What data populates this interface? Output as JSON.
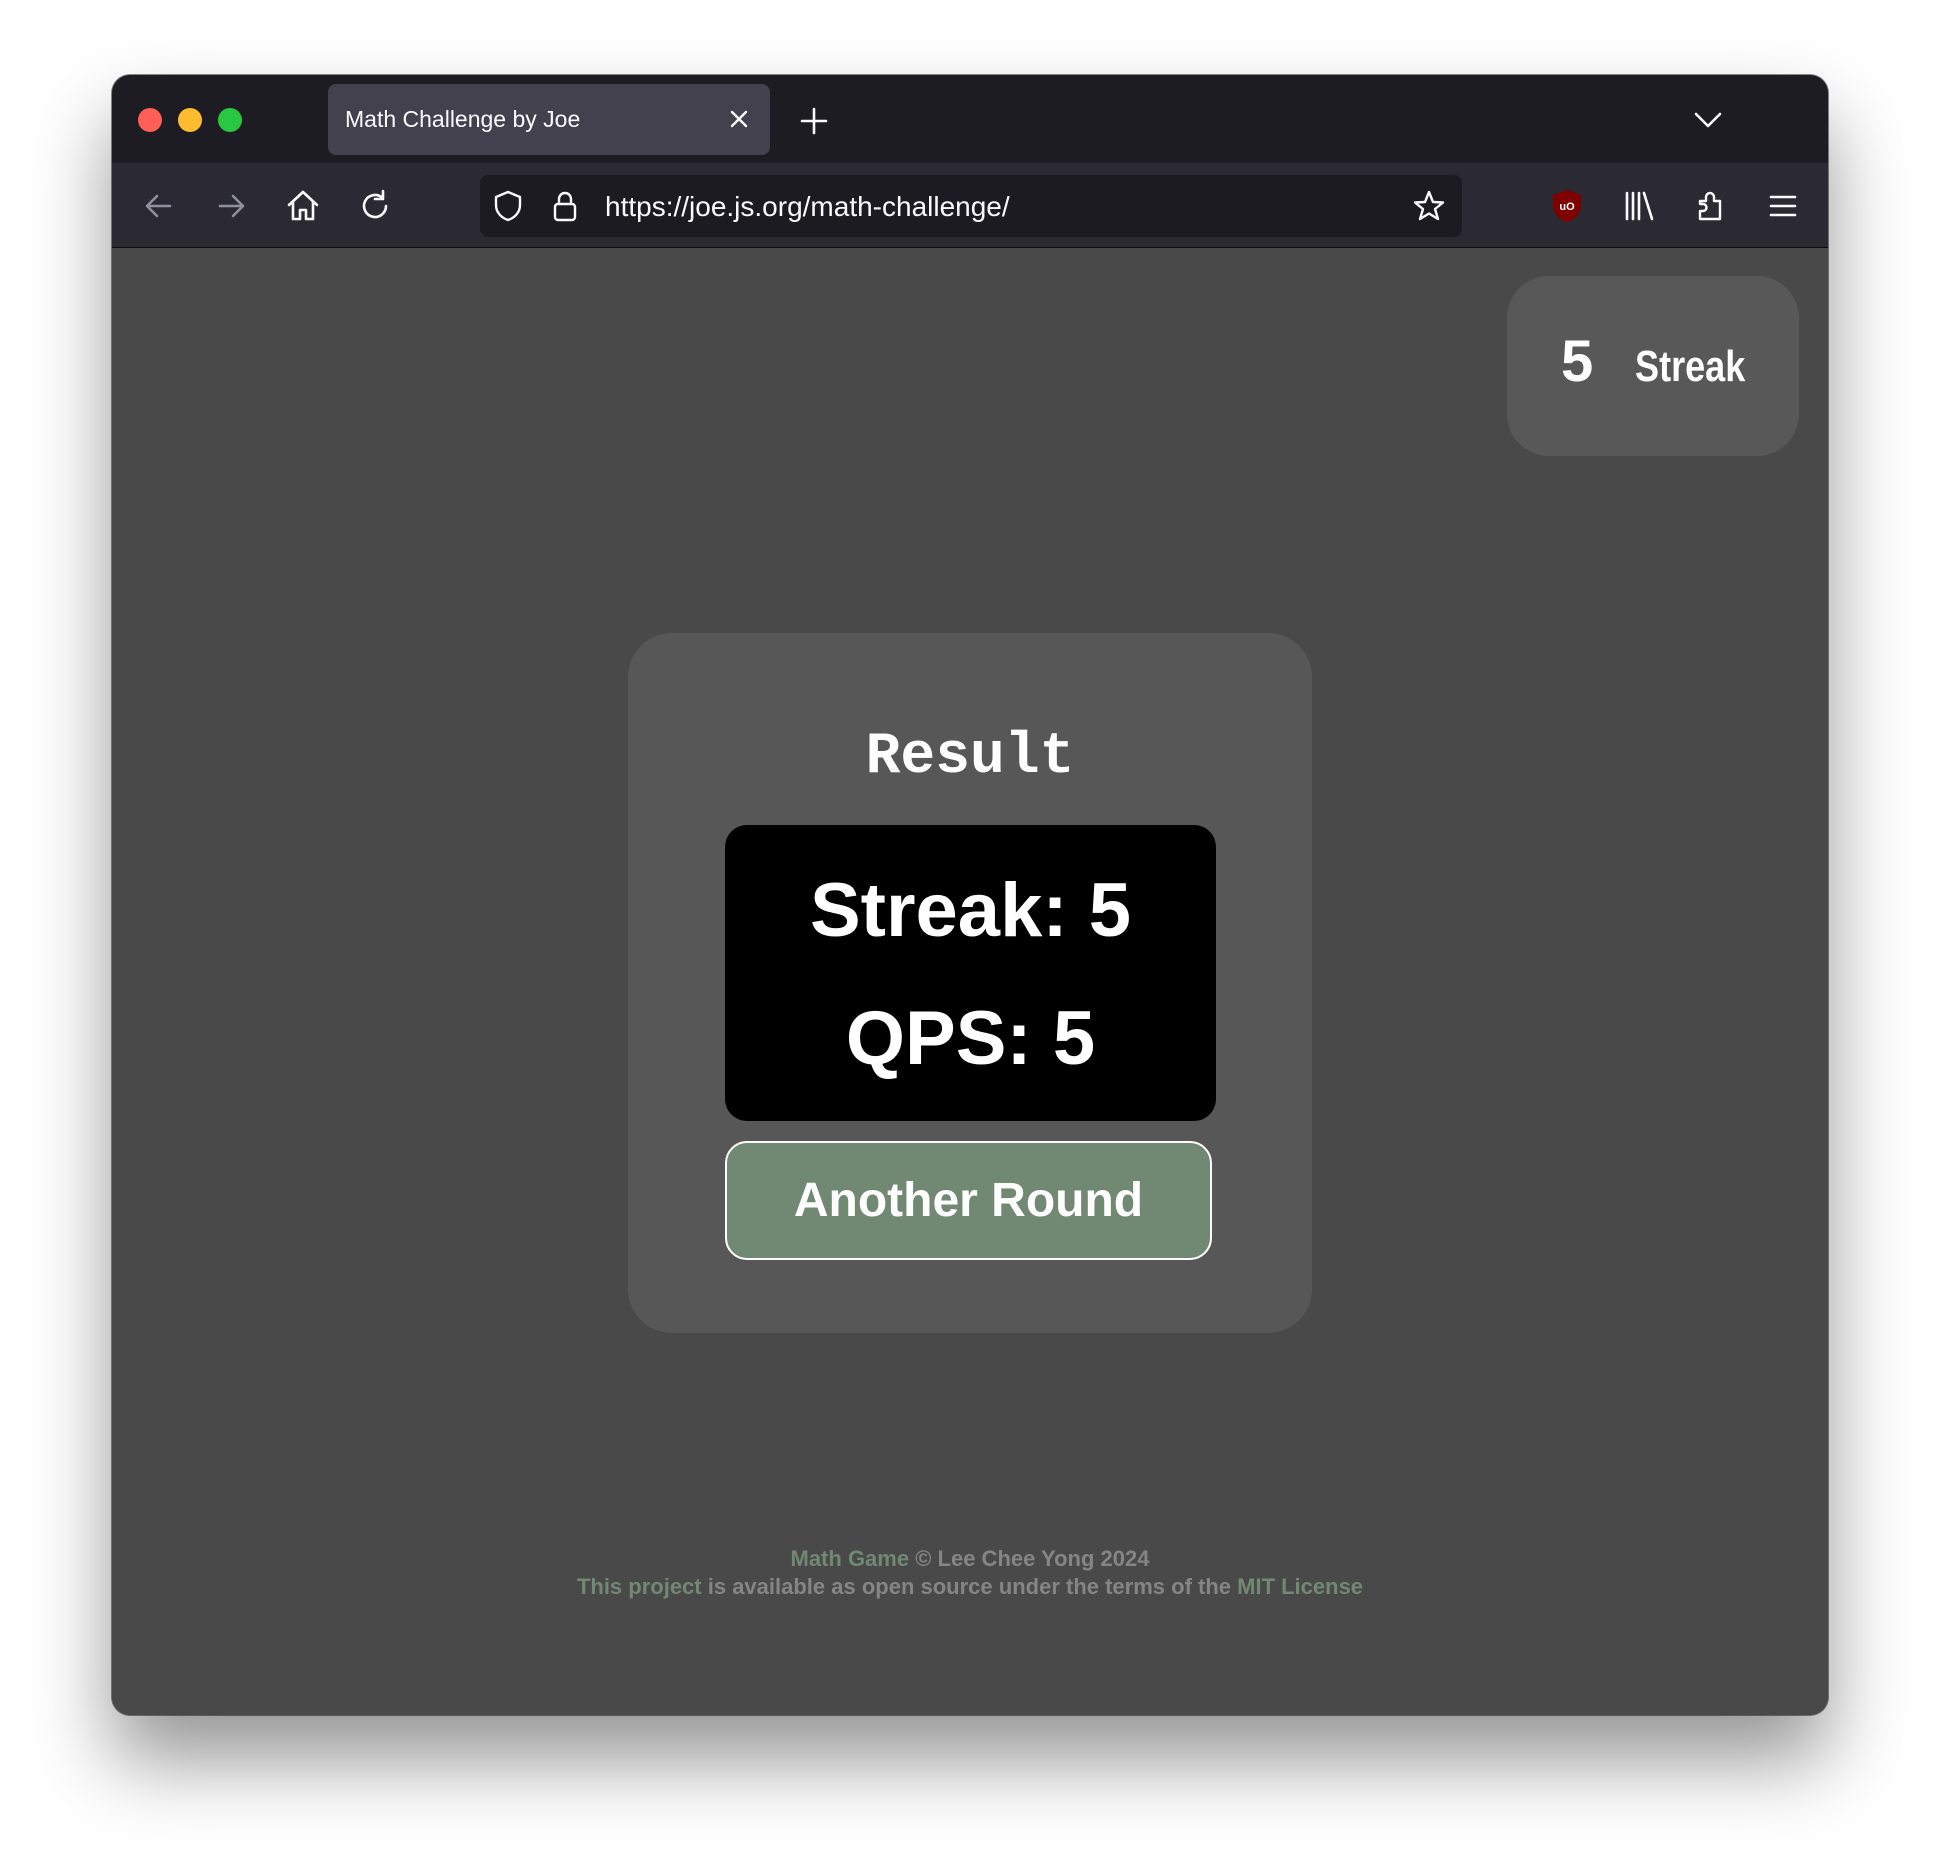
{
  "browser": {
    "tab_title": "Math Challenge by Joe",
    "url": "https://joe.js.org/math-challenge/"
  },
  "header": {
    "streak_value": "5",
    "streak_label": "Streak"
  },
  "result": {
    "title": "Result",
    "streak_line": "Streak: 5",
    "qps_line": "QPS: 5",
    "another_round_label": "Another Round"
  },
  "footer": {
    "game_link": "Math Game",
    "copyright": " © Lee Chee Yong 2024",
    "project_link": "This project",
    "license_text": " is available as open source under the terms of the ",
    "license_link": "MIT License"
  },
  "colors": {
    "button_green": "#718872",
    "page_bg": "#494949",
    "card_bg": "#575757",
    "toolbar_bg": "#2b2a33"
  },
  "icons": [
    "back-icon",
    "forward-icon",
    "home-icon",
    "reload-icon",
    "shield-icon",
    "lock-icon",
    "star-icon",
    "ublock-icon",
    "library-icon",
    "extensions-icon",
    "menu-icon",
    "close-icon",
    "plus-icon",
    "chevron-down-icon"
  ]
}
